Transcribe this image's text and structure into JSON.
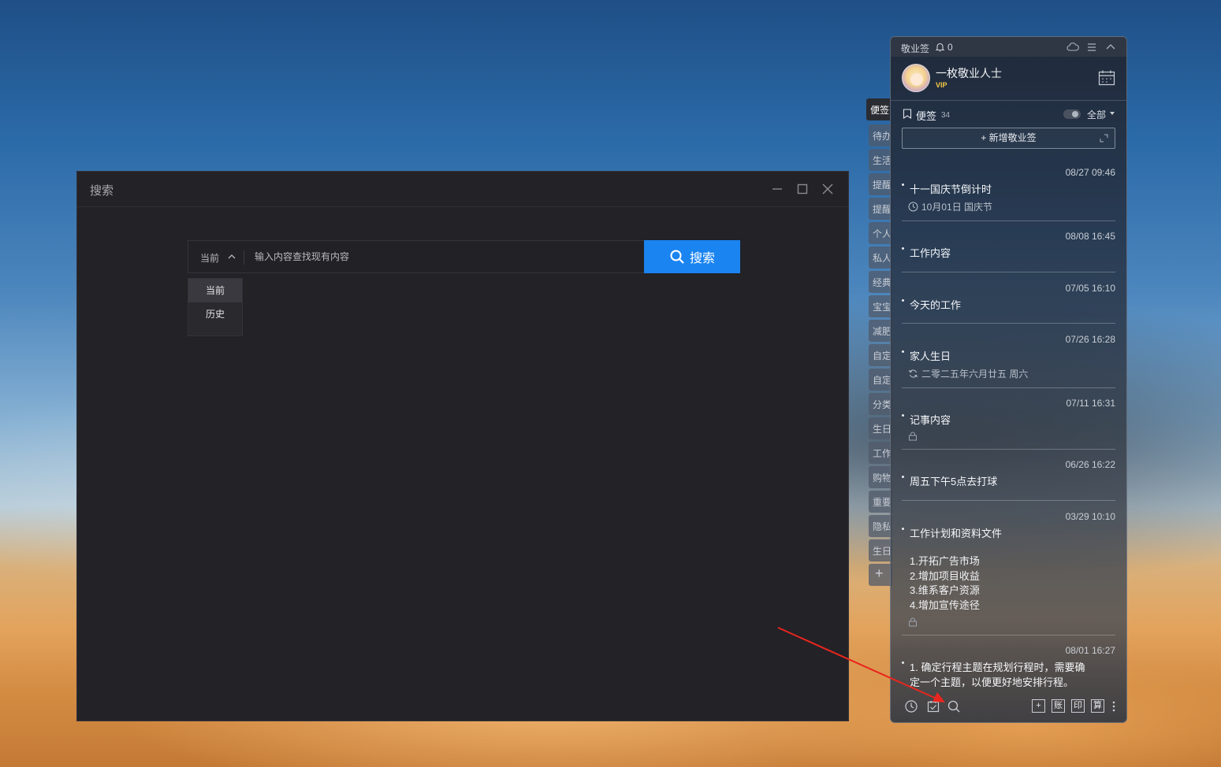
{
  "search_window": {
    "title": "搜索",
    "scope": {
      "selected": "当前",
      "options": [
        "当前",
        "历史"
      ]
    },
    "input_placeholder": "输入内容查找现有内容",
    "search_button": "搜索"
  },
  "side_tabs": [
    "便签",
    "待办",
    "生活",
    "提醒",
    "提醒",
    "个人",
    "私人",
    "经典",
    "宝宝",
    "减肥",
    "自定",
    "自定",
    "分类",
    "生日",
    "工作",
    "购物",
    "重要",
    "隐私",
    "生日",
    "+"
  ],
  "note_panel": {
    "app_name": "敬业签",
    "bell_count": "0",
    "user_name": "一枚敬业人士",
    "vip": "VIP",
    "notes_label": "便签",
    "notes_count": "34",
    "filter": "全部",
    "add_button": "+ 新增敬业签",
    "notes": [
      {
        "date": "08/27 09:46",
        "title": "十一国庆节倒计时",
        "sub": "10月01日 国庆节"
      },
      {
        "date": "08/08 16:45",
        "title": "工作内容"
      },
      {
        "date": "07/05 16:10",
        "title": "今天的工作"
      },
      {
        "date": "07/26 16:28",
        "title": "家人生日",
        "sub": "二零二五年六月廿五 周六"
      },
      {
        "date": "07/11 16:31",
        "title": "记事内容"
      },
      {
        "date": "06/26 16:22",
        "title": "周五下午5点去打球"
      },
      {
        "date": "03/29 10:10",
        "title": "工作计划和资料文件",
        "lines": [
          "1.开拓广告市场",
          "2.增加项目收益",
          "3.维系客户资源",
          "4.增加宣传途径"
        ]
      },
      {
        "date": "08/01 16:27",
        "title": "1. 确定行程主题在规划行程时，需要确",
        "title2": "定一个主题，以便更好地安排行程。"
      }
    ],
    "bottom_bar": {
      "add": "+",
      "account": "账",
      "print": "印",
      "calc": "算"
    }
  },
  "colors": {
    "search_button": "#1a84f0",
    "window_bg": "#232227",
    "vip": "#f6c944"
  }
}
